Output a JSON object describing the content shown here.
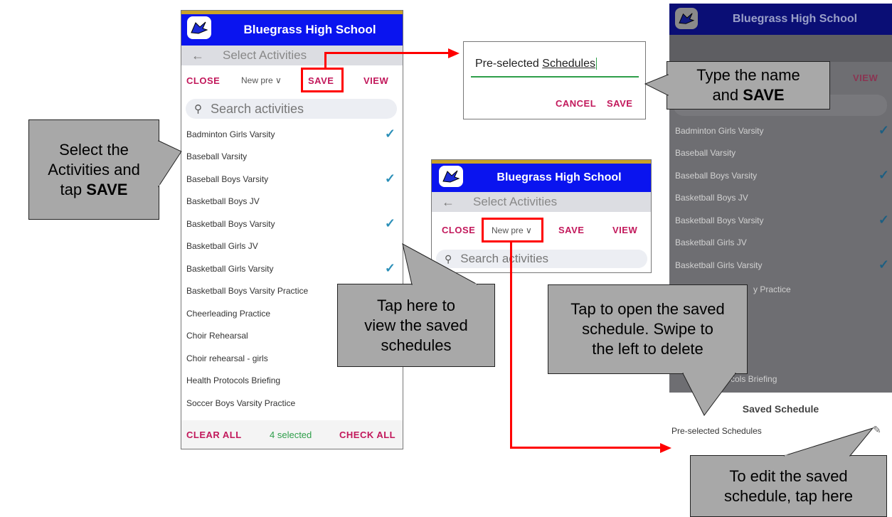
{
  "app": {
    "school_name": "Bluegrass High School",
    "page_title": "Select Activities",
    "back_icon": "arrow-left-icon",
    "logo_icon": "eagle-logo-icon"
  },
  "toolbar": {
    "close": "CLOSE",
    "dropdown_value": "New pre",
    "save": "SAVE",
    "view": "VIEW"
  },
  "search": {
    "placeholder": "Search activities"
  },
  "activities": [
    {
      "name": "Badminton Girls Varsity",
      "checked": true
    },
    {
      "name": "Baseball Varsity",
      "checked": false
    },
    {
      "name": "Baseball Boys Varsity",
      "checked": true
    },
    {
      "name": "Basketball Boys JV",
      "checked": false
    },
    {
      "name": "Basketball Boys Varsity",
      "checked": true
    },
    {
      "name": "Basketball Girls JV",
      "checked": false
    },
    {
      "name": "Basketball Girls Varsity",
      "checked": true
    },
    {
      "name": "Basketball Boys Varsity Practice",
      "checked": false
    },
    {
      "name": "Cheerleading Practice",
      "checked": false
    },
    {
      "name": "Choir Rehearsal",
      "checked": false
    },
    {
      "name": "Choir rehearsal - girls",
      "checked": false
    },
    {
      "name": "Health Protocols Briefing",
      "checked": false
    },
    {
      "name": "Soccer Boys Varsity Practice",
      "checked": false
    }
  ],
  "footer": {
    "clear_all": "CLEAR ALL",
    "selected": "4 selected",
    "check_all": "CHECK ALL"
  },
  "dialog": {
    "input_value_prefix": "Pre-selected ",
    "input_value_word": "Schedules",
    "cancel": "CANCEL",
    "save": "SAVE"
  },
  "right_screen": {
    "partial_item": "y Practice",
    "partial_item2": "cols Briefing",
    "saved_title": "Saved Schedule",
    "saved_item": "Pre-selected Schedules"
  },
  "callouts": {
    "select": {
      "line1": "Select the",
      "line2": "Activities and",
      "line3_prefix": "tap ",
      "line3_bold": "SAVE"
    },
    "type": {
      "line1": "Type the name",
      "line2_prefix": "and ",
      "line2_bold": "SAVE"
    },
    "tap_here": {
      "line1": "Tap here to",
      "line2": "view the saved",
      "line3": "schedules"
    },
    "open": {
      "line1": "Tap to open the saved",
      "line2": "schedule. Swipe to",
      "line3": "the left to delete"
    },
    "edit": {
      "line1": "To edit the saved",
      "line2": "schedule, tap here"
    }
  },
  "colors": {
    "header_blue": "#0a14ef",
    "accent_pink": "#c2185b",
    "check_blue": "#2b8fb8",
    "selected_green": "#2e9e4a",
    "highlight_red": "#ff0000",
    "callout_gray": "#a8a8a8"
  }
}
